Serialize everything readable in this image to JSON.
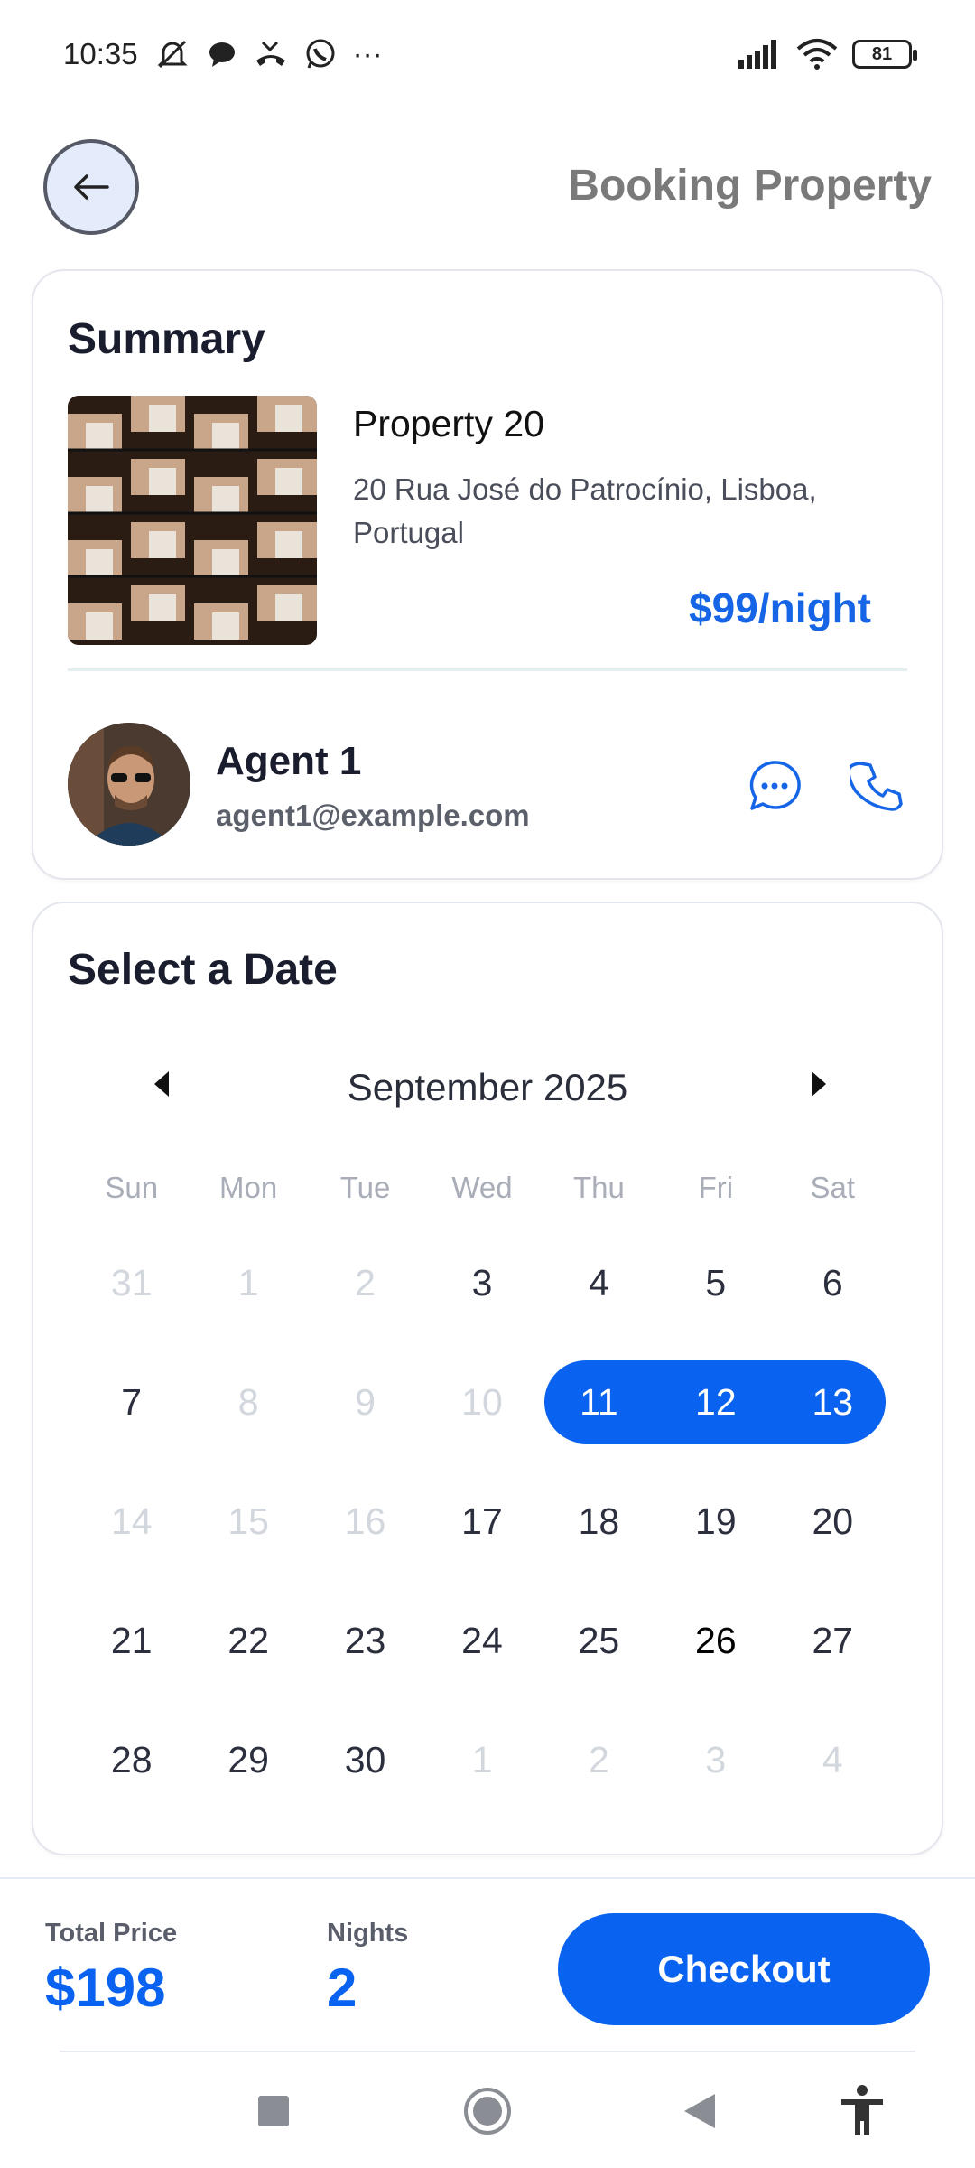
{
  "status_bar": {
    "time": "10:35",
    "more": "···",
    "battery": "81"
  },
  "header": {
    "title": "Booking Property"
  },
  "summary": {
    "title": "Summary",
    "property_name": "Property 20",
    "address": "20 Rua José do Patrocínio, Lisboa, Portugal",
    "price": "$99/night",
    "agent_name": "Agent 1",
    "agent_email": "agent1@example.com"
  },
  "calendar": {
    "title": "Select a Date",
    "month": "September 2025",
    "weekdays": [
      "Sun",
      "Mon",
      "Tue",
      "Wed",
      "Thu",
      "Fri",
      "Sat"
    ],
    "weeks": [
      [
        {
          "d": "31",
          "s": "muted"
        },
        {
          "d": "1",
          "s": "muted"
        },
        {
          "d": "2",
          "s": "muted"
        },
        {
          "d": "3",
          "s": ""
        },
        {
          "d": "4",
          "s": ""
        },
        {
          "d": "5",
          "s": ""
        },
        {
          "d": "6",
          "s": ""
        }
      ],
      [
        {
          "d": "7",
          "s": ""
        },
        {
          "d": "8",
          "s": "muted"
        },
        {
          "d": "9",
          "s": "muted"
        },
        {
          "d": "10",
          "s": "muted"
        },
        {
          "d": "11",
          "s": "selected"
        },
        {
          "d": "12",
          "s": "selected"
        },
        {
          "d": "13",
          "s": "selected"
        }
      ],
      [
        {
          "d": "14",
          "s": "muted"
        },
        {
          "d": "15",
          "s": "muted"
        },
        {
          "d": "16",
          "s": "muted"
        },
        {
          "d": "17",
          "s": ""
        },
        {
          "d": "18",
          "s": ""
        },
        {
          "d": "19",
          "s": ""
        },
        {
          "d": "20",
          "s": ""
        }
      ],
      [
        {
          "d": "21",
          "s": ""
        },
        {
          "d": "22",
          "s": ""
        },
        {
          "d": "23",
          "s": ""
        },
        {
          "d": "24",
          "s": ""
        },
        {
          "d": "25",
          "s": ""
        },
        {
          "d": "26",
          "s": "today"
        },
        {
          "d": "27",
          "s": ""
        }
      ],
      [
        {
          "d": "28",
          "s": ""
        },
        {
          "d": "29",
          "s": ""
        },
        {
          "d": "30",
          "s": ""
        },
        {
          "d": "1",
          "s": "muted"
        },
        {
          "d": "2",
          "s": "muted"
        },
        {
          "d": "3",
          "s": "muted"
        },
        {
          "d": "4",
          "s": "muted"
        }
      ]
    ],
    "selected_color": "#0a63f0"
  },
  "footer": {
    "total_label": "Total Price",
    "total_value": "$198",
    "nights_label": "Nights",
    "nights_value": "2",
    "checkout_label": "Checkout"
  },
  "colors": {
    "accent": "#0a63f0",
    "price": "#1565e6",
    "muted": "#d2d6dd"
  }
}
